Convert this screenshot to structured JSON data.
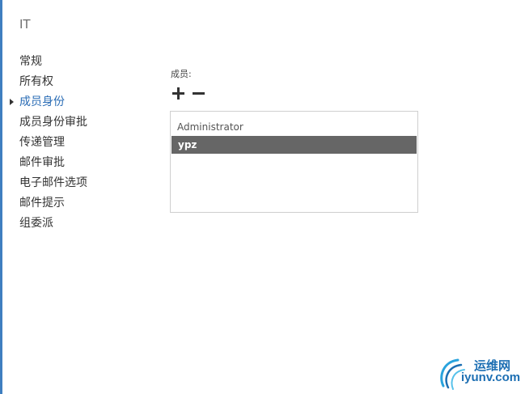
{
  "page": {
    "title": "IT"
  },
  "nav": {
    "items": [
      {
        "label": "常规"
      },
      {
        "label": "所有权"
      },
      {
        "label": "成员身份"
      },
      {
        "label": "成员身份审批"
      },
      {
        "label": "传递管理"
      },
      {
        "label": "邮件审批"
      },
      {
        "label": "电子邮件选项"
      },
      {
        "label": "邮件提示"
      },
      {
        "label": "组委派"
      }
    ],
    "active_index": 2
  },
  "members": {
    "label": "成员:",
    "add_icon": "plus-icon",
    "remove_icon": "minus-icon",
    "rows": [
      {
        "name": "Administrator",
        "selected": false
      },
      {
        "name": "ypz",
        "selected": true
      }
    ]
  },
  "watermark": {
    "line1": "运维网",
    "line2": "iyunv.com"
  },
  "colors": {
    "accent": "#2a6cb5",
    "selection": "#666666",
    "left_edge": "#3f7fc0"
  }
}
